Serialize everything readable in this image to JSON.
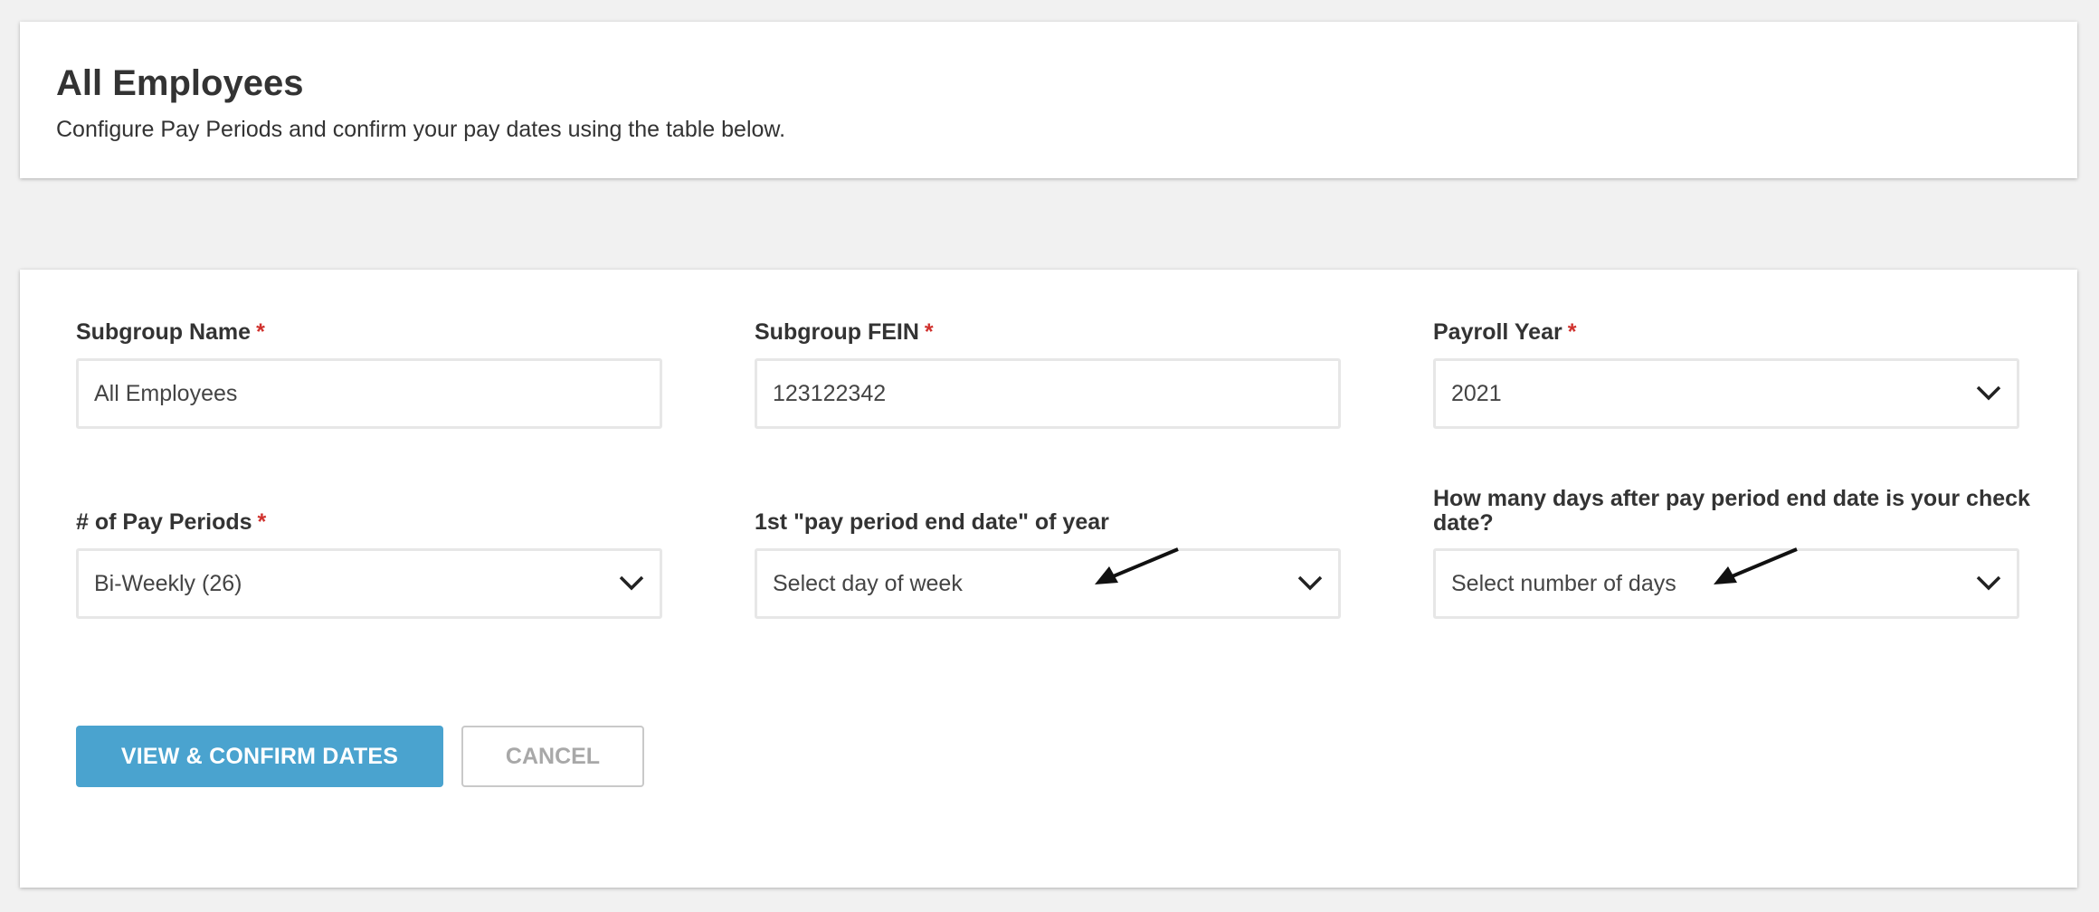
{
  "header": {
    "title": "All Employees",
    "subtitle": "Configure Pay Periods and confirm your pay dates using the table below."
  },
  "form": {
    "subgroup_name": {
      "label": "Subgroup Name",
      "required_mark": "*",
      "value": "All Employees"
    },
    "subgroup_fein": {
      "label": "Subgroup FEIN",
      "required_mark": "*",
      "value": "123122342"
    },
    "payroll_year": {
      "label": "Payroll Year",
      "required_mark": "*",
      "value": "2021"
    },
    "pay_periods": {
      "label": "# of Pay Periods",
      "required_mark": "*",
      "value": "Bi-Weekly (26)"
    },
    "first_end_date": {
      "label": "1st \"pay period end date\" of year",
      "placeholder": "Select day of week"
    },
    "check_days": {
      "label": "How many days after pay period end date is your check date?",
      "placeholder": "Select number of days"
    }
  },
  "actions": {
    "confirm_label": "VIEW & CONFIRM DATES",
    "cancel_label": "CANCEL"
  },
  "colors": {
    "primary": "#4aa3cf",
    "required": "#d0312d",
    "background": "#f1f1f1"
  },
  "icons": [
    "chevron-down-icon",
    "arrow-annotation-icon"
  ]
}
